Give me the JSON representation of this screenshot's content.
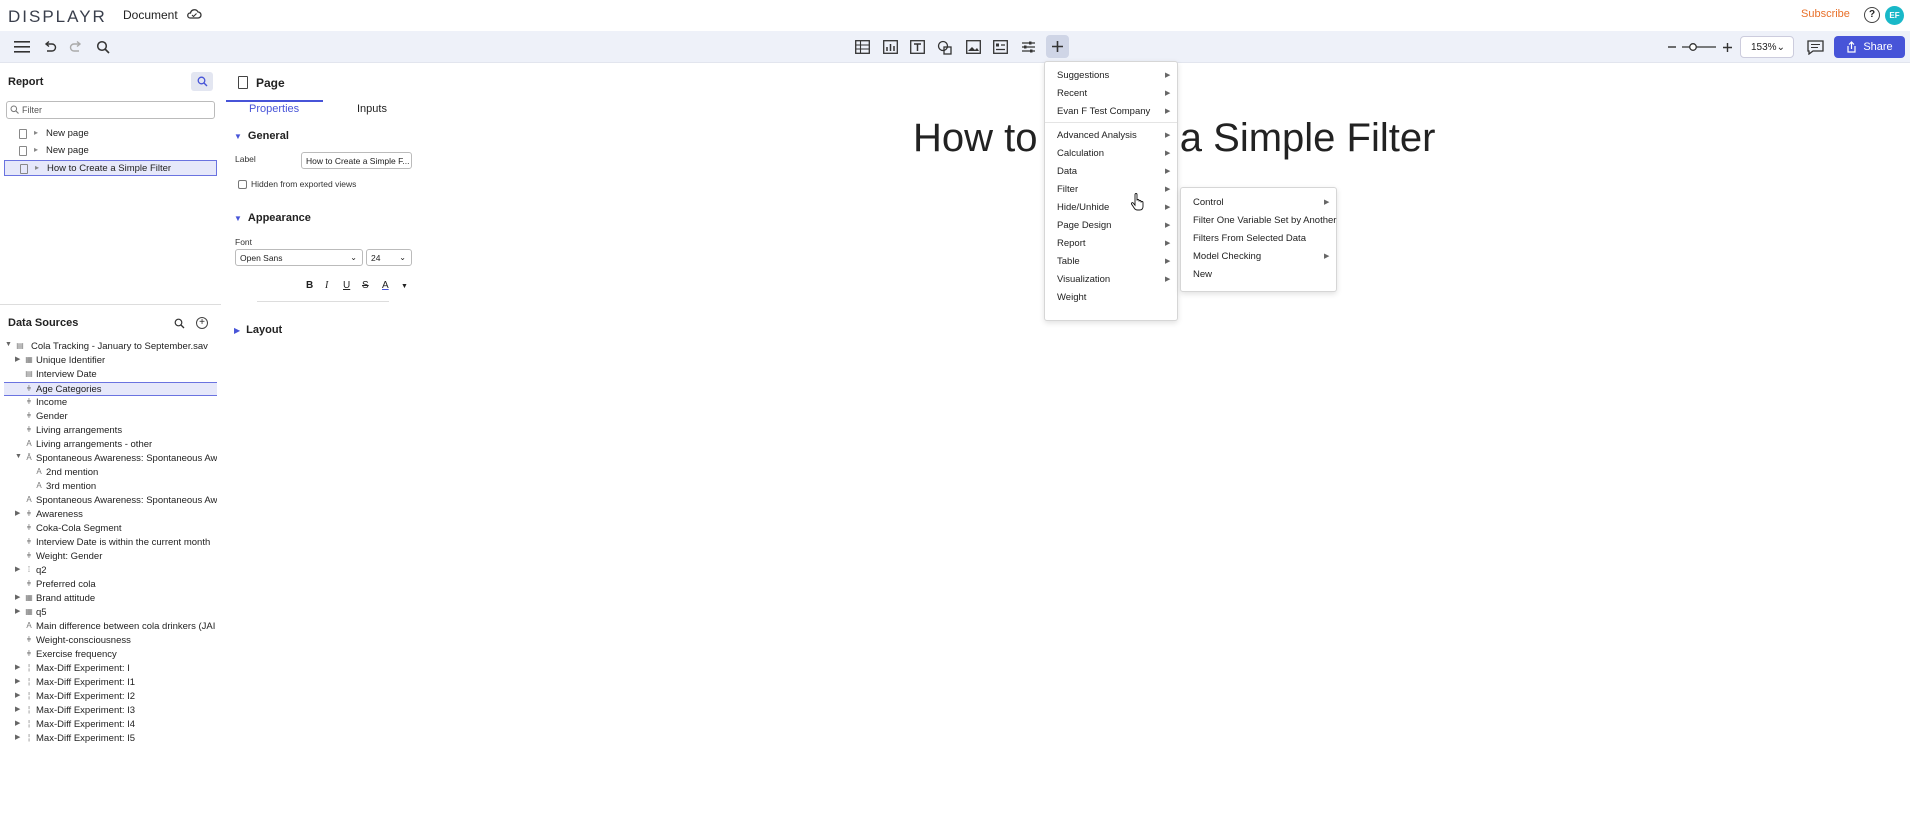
{
  "brand": {
    "logo_prefix": "D",
    "logo_rest": "ISPLAYR"
  },
  "app": {
    "doc_title": "Document",
    "subscribe": "Subscribe",
    "help": "?",
    "avatar_initials": "EF",
    "zoom": "153%",
    "share": "Share"
  },
  "report_panel": {
    "title": "Report",
    "filter_placeholder": "Filter",
    "pages": [
      "New page",
      "New page",
      "How to Create a Simple Filter"
    ]
  },
  "data_sources": {
    "title": "Data Sources",
    "file": "Cola Tracking - January to September.sav",
    "items": [
      {
        "label": "Unique Identifier",
        "indent": 1,
        "expand": true
      },
      {
        "label": "Interview Date",
        "indent": 1,
        "expand": false
      },
      {
        "label": "Age Categories",
        "indent": 1,
        "expand": false,
        "selected": true
      },
      {
        "label": "Income",
        "indent": 1,
        "expand": false
      },
      {
        "label": "Gender",
        "indent": 1,
        "expand": false
      },
      {
        "label": "Living arrangements",
        "indent": 1,
        "expand": false
      },
      {
        "label": "Living arrangements - other",
        "indent": 1,
        "expand": false
      },
      {
        "label": "Spontaneous Awareness: Spontaneous Awa",
        "indent": 1,
        "expand": true,
        "open": true
      },
      {
        "label": "2nd mention",
        "indent": 2,
        "expand": false
      },
      {
        "label": "3rd mention",
        "indent": 2,
        "expand": false
      },
      {
        "label": "Spontaneous Awareness: Spontaneous Awa",
        "indent": 1,
        "expand": false
      },
      {
        "label": "Awareness",
        "indent": 1,
        "expand": true
      },
      {
        "label": "Coka-Cola Segment",
        "indent": 1,
        "expand": false
      },
      {
        "label": "Interview Date is within the current month",
        "indent": 1,
        "expand": false
      },
      {
        "label": "Weight: Gender",
        "indent": 1,
        "expand": false
      },
      {
        "label": "q2",
        "indent": 1,
        "expand": true
      },
      {
        "label": "Preferred cola",
        "indent": 1,
        "expand": false
      },
      {
        "label": "Brand attitude",
        "indent": 1,
        "expand": true
      },
      {
        "label": "q5",
        "indent": 1,
        "expand": true
      },
      {
        "label": "Main difference between cola drinkers (JAI",
        "indent": 1,
        "expand": false
      },
      {
        "label": "Weight-consciousness",
        "indent": 1,
        "expand": false
      },
      {
        "label": "Exercise frequency",
        "indent": 1,
        "expand": false
      },
      {
        "label": "Max-Diff Experiment: I",
        "indent": 1,
        "expand": true
      },
      {
        "label": "Max-Diff Experiment: I1",
        "indent": 1,
        "expand": true
      },
      {
        "label": "Max-Diff Experiment: I2",
        "indent": 1,
        "expand": true
      },
      {
        "label": "Max-Diff Experiment: I3",
        "indent": 1,
        "expand": true
      },
      {
        "label": "Max-Diff Experiment: I4",
        "indent": 1,
        "expand": true
      },
      {
        "label": "Max-Diff Experiment: I5",
        "indent": 1,
        "expand": true
      }
    ]
  },
  "properties": {
    "title": "Page",
    "tab_properties": "Properties",
    "tab_inputs": "Inputs",
    "general": "General",
    "label_label": "Label",
    "label_value": "How to Create a Simple F...",
    "hidden_label": "Hidden from exported views",
    "appearance": "Appearance",
    "font_label": "Font",
    "font_value": "Open Sans",
    "font_size": "24",
    "layout": "Layout"
  },
  "canvas": {
    "title": "How to Create a Simple Filter"
  },
  "menu": {
    "group1": [
      "Suggestions",
      "Recent",
      "Evan F Test Company"
    ],
    "group2": [
      "Advanced Analysis",
      "Calculation",
      "Data",
      "Filter",
      "Hide/Unhide",
      "Page Design",
      "Report",
      "Table",
      "Visualization",
      "Weight"
    ],
    "submenu": [
      "Control",
      "Filter One Variable Set by Another",
      "Filters From Selected Data",
      "Model Checking",
      "New"
    ]
  },
  "colors": {
    "accent": "#4754d8",
    "subscribe": "#e8702a",
    "avatar": "#19b8c8"
  }
}
